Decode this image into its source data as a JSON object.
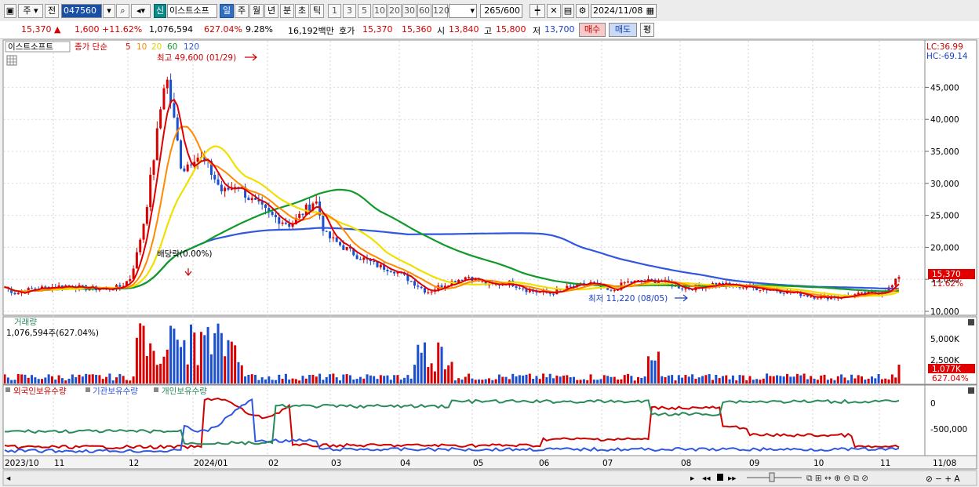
{
  "toolbar": {
    "period_opt": "주",
    "prev_label": "전",
    "stock_code": "047560",
    "new_label": "신",
    "stock_name": "이스트소프",
    "tabs": [
      "일",
      "주",
      "월",
      "년",
      "분",
      "초",
      "틱"
    ],
    "intervals": [
      "1",
      "3",
      "5",
      "10",
      "20",
      "30",
      "60",
      "120"
    ],
    "count": "265",
    "count_total": "/600",
    "date": "2024/11/08"
  },
  "info": {
    "price": "15,370 ▲",
    "change": "1,600 +11.62%",
    "volume": "1,076,594",
    "volume_pct": "627.04%",
    "turnover_pct": "9.28%",
    "amount": "16,192백만",
    "ask_label": "호가",
    "ask1": "15,370",
    "ask2": "15,360",
    "open_label": "시",
    "open": "13,840",
    "high_label": "고",
    "high": "15,800",
    "low_label": "저",
    "low": "13,700",
    "buy_label": "매수",
    "sell_label": "매도",
    "eval_label": "평"
  },
  "price_panel": {
    "stock_tag": "이스트소프트",
    "ma_title": "종가 단순",
    "ma_periods": [
      "5",
      "10",
      "20",
      "60",
      "120"
    ],
    "ma_colors": [
      "#e00000",
      "#ff8a00",
      "#f0e000",
      "#119a2a",
      "#2f57e0",
      "#2aa8e0"
    ],
    "high_note": "최고 49,600 (01/29)",
    "low_note": "최저 11,220 (08/05)",
    "dividend_note": "배당락(0.00%)",
    "lc": "LC:36.99",
    "hc": "HC:-69.14",
    "price_ticks": [
      "45,000",
      "40,000",
      "35,000",
      "30,000",
      "25,000",
      "20,000",
      "15,000",
      "10,000"
    ],
    "current_tag": "15,370",
    "current_pct": "11.62%"
  },
  "volume_panel": {
    "title": "거래량",
    "value_note": "1,076,594주(627.04%)",
    "ticks": [
      "5,000K",
      "2,500K"
    ],
    "current_tag": "1,077K",
    "current_pct": "627.04%"
  },
  "holdings_panel": {
    "series_labels": [
      "외국인보유수량",
      "기관보유수량",
      "개인보유수량"
    ],
    "series_colors": [
      "#d00000",
      "#2f57e0",
      "#2a8a5a"
    ],
    "ticks": [
      "0",
      "-500,000"
    ]
  },
  "x_axis": [
    "2023/10",
    "11",
    "12",
    "2024/01",
    "02",
    "03",
    "04",
    "05",
    "06",
    "07",
    "08",
    "09",
    "10",
    "11",
    "11/08"
  ]
}
